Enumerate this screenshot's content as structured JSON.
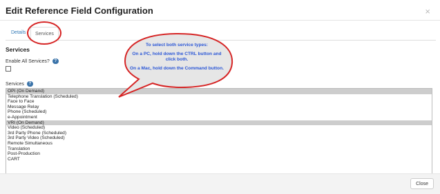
{
  "dialog": {
    "title": "Edit Reference Field Configuration",
    "close_icon": "×"
  },
  "tabs": [
    {
      "label": "Details",
      "active": false
    },
    {
      "label": "Services",
      "active": true
    }
  ],
  "section": {
    "heading": "Services",
    "enable_all_label": "Enable All Services?",
    "enable_all_checked": false,
    "help_badge": "?",
    "services_label": "Services"
  },
  "callout": {
    "lines": [
      "To select both service types:",
      "On a PC, hold down the CTRL button and click both.",
      "On a Mac, hold down the Command button."
    ],
    "color": "#2a56d6",
    "annotation_color": "#d62424"
  },
  "services_list": [
    {
      "label": "OPI (On Demand)",
      "selected": true
    },
    {
      "label": "Telephone Translation (Scheduled)",
      "selected": false
    },
    {
      "label": "Face to Face",
      "selected": false
    },
    {
      "label": "Message Relay",
      "selected": false
    },
    {
      "label": "Phone (Scheduled)",
      "selected": false
    },
    {
      "label": "e-Appointment",
      "selected": false
    },
    {
      "label": "VRI (On Demand)",
      "selected": true
    },
    {
      "label": "Video (Scheduled)",
      "selected": false
    },
    {
      "label": "3rd Party Phone (Scheduled)",
      "selected": false
    },
    {
      "label": "3rd Party Video (Scheduled)",
      "selected": false
    },
    {
      "label": "Remote Simultaneous",
      "selected": false
    },
    {
      "label": "Translation",
      "selected": false
    },
    {
      "label": "Post-Production",
      "selected": false
    },
    {
      "label": "CART",
      "selected": false
    }
  ],
  "footer": {
    "close_label": "Close"
  }
}
